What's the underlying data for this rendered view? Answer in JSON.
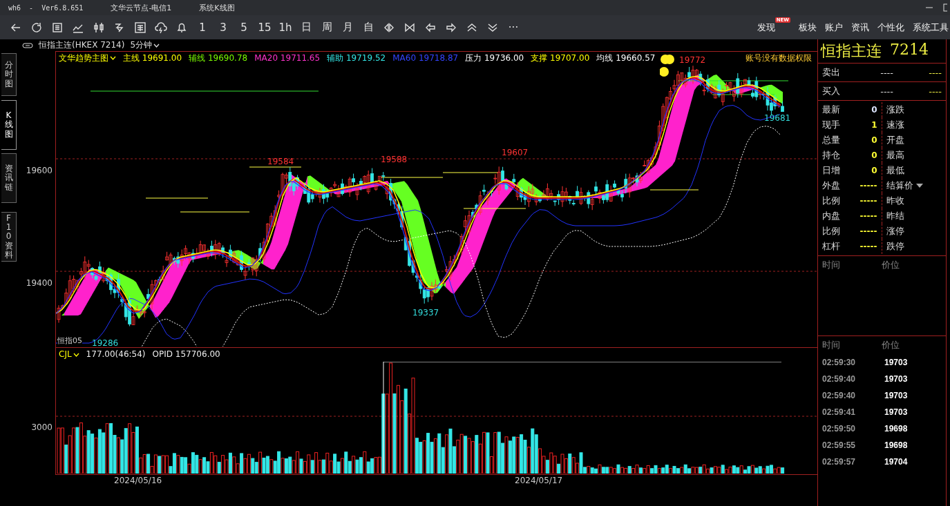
{
  "title_bar": {
    "app": "wh6  -  Ver6.8.651",
    "server": "文华云节点-电信1",
    "view": "系统K线图"
  },
  "toolbar": {
    "periods": [
      "1",
      "3",
      "5",
      "15",
      "1h",
      "日",
      "周",
      "月",
      "自"
    ],
    "more": "···",
    "menu": [
      {
        "label": "发现",
        "badge": "NEW"
      },
      {
        "label": "板块"
      },
      {
        "label": "账户"
      },
      {
        "label": "资讯"
      },
      {
        "label": "个性化"
      },
      {
        "label": "系统工具"
      }
    ]
  },
  "side_tabs": [
    {
      "label": "分时图",
      "selected": false
    },
    {
      "label": "K线图",
      "selected": true
    },
    {
      "label": "资讯链",
      "selected": false
    },
    {
      "label": "F10资料",
      "selected": false
    }
  ],
  "contract_bar": {
    "name": "恒指主连(HKEX 7214)",
    "period": "5分钟"
  },
  "price_chart": {
    "indicator": "文华趋势主图",
    "notice": "账号没有数据权限",
    "corner_label": "恒指05",
    "legend": [
      {
        "label": "主线",
        "value": "19691.00",
        "color": "#ffff00"
      },
      {
        "label": "辅线",
        "value": "19690.78",
        "color": "#7cfc00"
      },
      {
        "label": "MA20",
        "value": "19711.65",
        "color": "#ff33cc"
      },
      {
        "label": "辅助",
        "value": "19719.52",
        "color": "#33e6e6"
      },
      {
        "label": "MA60",
        "value": "19718.87",
        "color": "#3344ff"
      },
      {
        "label": "压力",
        "value": "19736.00",
        "color": "#ffffff"
      },
      {
        "label": "支撑",
        "value": "19707.00",
        "color": "#ffff00"
      },
      {
        "label": "均线",
        "value": "19660.57",
        "color": "#ffffff"
      }
    ],
    "y_labels": [
      "19600",
      "19400"
    ],
    "annotations": [
      {
        "text": "19772",
        "kind": "high"
      },
      {
        "text": "19607",
        "kind": "high"
      },
      {
        "text": "19588",
        "kind": "high"
      },
      {
        "text": "19584",
        "kind": "high"
      },
      {
        "text": "19337",
        "kind": "low"
      },
      {
        "text": "19681",
        "kind": "low"
      },
      {
        "text": "19286",
        "kind": "low"
      }
    ]
  },
  "volume_chart": {
    "indicator": "CJL",
    "reading": "177.00(46:54)",
    "opid": "OPID 157706.00",
    "y_label": "3000"
  },
  "dates": [
    "2024/05/16",
    "2024/05/17"
  ],
  "quote": {
    "name": "恒指主连",
    "code": "7214",
    "book": [
      {
        "label": "卖出",
        "price": "----",
        "volume": "----"
      },
      {
        "label": "买入",
        "price": "----",
        "volume": "----"
      }
    ],
    "rows": [
      {
        "label": "最新",
        "value": "0",
        "color": "#dde6ff",
        "right": "涨跌",
        "menu": false
      },
      {
        "label": "现手",
        "value": "1",
        "color": "#ffff33",
        "right": "速涨",
        "menu": false
      },
      {
        "label": "总量",
        "value": "0",
        "color": "#ffff33",
        "right": "开盘",
        "menu": false
      },
      {
        "label": "持仓",
        "value": "0",
        "color": "#ffff33",
        "right": "最高",
        "menu": false
      },
      {
        "label": "日增",
        "value": "0",
        "color": "#ffff33",
        "right": "最低",
        "menu": false
      },
      {
        "label": "外盘",
        "value": "-----",
        "color": "#ffff33",
        "right": "结算价",
        "menu": true
      },
      {
        "label": "比例",
        "value": "-----",
        "color": "#ffff33",
        "right": "昨收",
        "menu": false
      },
      {
        "label": "内盘",
        "value": "-----",
        "color": "#ffff33",
        "right": "昨结",
        "menu": false
      },
      {
        "label": "比例",
        "value": "-----",
        "color": "#ffff33",
        "right": "涨停",
        "menu": false
      },
      {
        "label": "杠杆",
        "value": "-----",
        "color": "#ffff33",
        "right": "跌停",
        "menu": false
      }
    ],
    "trades_header": [
      "时间",
      "价位"
    ],
    "ticks_header": [
      "时间",
      "价位"
    ],
    "ticks": [
      {
        "time": "02:59:30",
        "price": "19703"
      },
      {
        "time": "02:59:40",
        "price": "19703"
      },
      {
        "time": "02:59:40",
        "price": "19703"
      },
      {
        "time": "02:59:41",
        "price": "19703"
      },
      {
        "time": "02:59:50",
        "price": "19698"
      },
      {
        "time": "02:59:55",
        "price": "19698"
      },
      {
        "time": "02:59:57",
        "price": "19704"
      }
    ]
  }
}
